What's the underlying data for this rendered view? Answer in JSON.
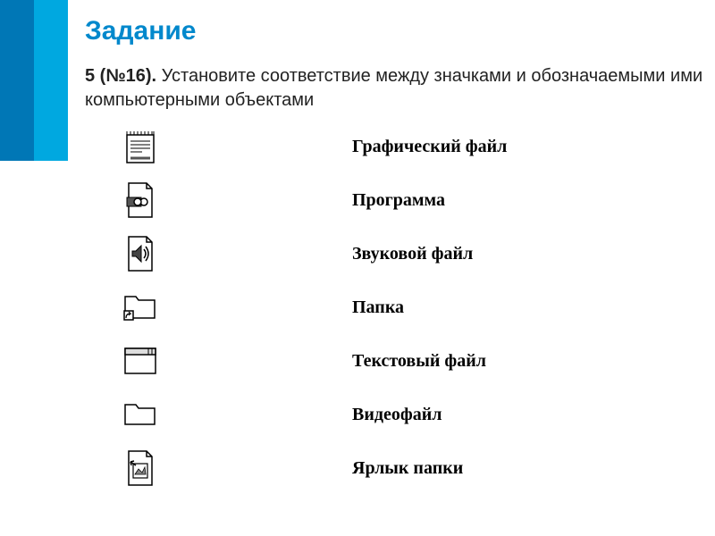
{
  "title": "Задание",
  "task": {
    "prefix_bold": "5 (№16).",
    "body": " Установите соответствие между значками и обозначаемыми ими компьютерными объектами"
  },
  "rows": [
    {
      "icon_name": "text-document-icon",
      "label": "Графический файл"
    },
    {
      "icon_name": "video-file-icon",
      "label": "Программа"
    },
    {
      "icon_name": "audio-file-icon",
      "label": "Звуковой файл"
    },
    {
      "icon_name": "folder-shortcut-icon",
      "label": "Папка"
    },
    {
      "icon_name": "program-window-icon",
      "label": "Текстовый файл"
    },
    {
      "icon_name": "folder-icon",
      "label": "Видеофайл"
    },
    {
      "icon_name": "image-file-icon",
      "label": "Ярлык папки"
    }
  ]
}
